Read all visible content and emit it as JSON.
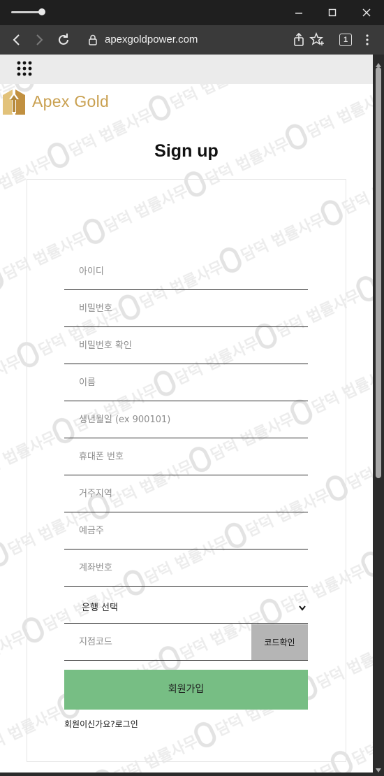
{
  "browser": {
    "url": "apexgoldpower.com",
    "tab_count": "1"
  },
  "page": {
    "logo_text": "Apex Gold",
    "title": "Sign up",
    "watermark_text": "담덕 법률사무소"
  },
  "form": {
    "fields": [
      {
        "name": "username",
        "placeholder": "아이디"
      },
      {
        "name": "password",
        "placeholder": "비밀번호"
      },
      {
        "name": "password-confirm",
        "placeholder": "비밀번호 확인"
      },
      {
        "name": "name",
        "placeholder": "이름"
      },
      {
        "name": "birthdate",
        "placeholder": "생년월일 (ex 900101)"
      },
      {
        "name": "phone",
        "placeholder": "휴대폰 번호"
      },
      {
        "name": "region",
        "placeholder": "거주지역"
      },
      {
        "name": "account-holder",
        "placeholder": "예금주"
      },
      {
        "name": "account-number",
        "placeholder": "계좌번호"
      }
    ],
    "bank_select": "은행 선택",
    "branch_code_placeholder": "지점코드",
    "code_check_button": "코드확인",
    "submit_button": "회원가입",
    "login_link": "회원이신가요?로그인"
  },
  "colors": {
    "accent_gold": "#c9a050",
    "submit_green": "#77be84",
    "code_button_gray": "#b5b5b5"
  }
}
